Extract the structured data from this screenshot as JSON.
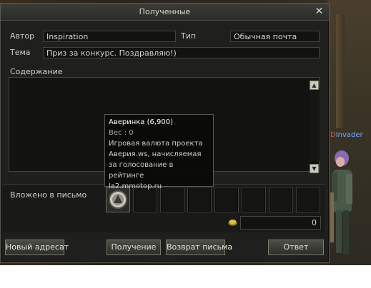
{
  "window": {
    "title": "Полученные",
    "close_glyph": "✕"
  },
  "header": {
    "author_label": "Автор",
    "author_value": "Inspiration",
    "type_label": "Тип",
    "type_value": "Обычная почта",
    "subject_label": "Тема",
    "subject_value": "Приз за конкурс. Поздравляю!)"
  },
  "content": {
    "label": "Содержание",
    "scroll_up_icon": "arrow-up-icon",
    "scroll_down_icon": "arrow-down-icon"
  },
  "attachments": {
    "label": "Вложено в письмо",
    "slot_count": 8,
    "item_icon": "coin-item-icon",
    "adena_amount": "0"
  },
  "tooltip": {
    "title": "Аверинка (6,900)",
    "weight": "Вес :  0",
    "description_lines": [
      "Игровая валюта проекта",
      "Аверия.ws, начисляемая",
      "за голосование в рейтинге",
      "la2.mmotop.ru"
    ]
  },
  "buttons": {
    "new_recipient": "Новый адресат",
    "receive": "Получение",
    "return": "Возврат письма",
    "reply": "Ответ"
  },
  "game": {
    "character_name": "Invader"
  }
}
